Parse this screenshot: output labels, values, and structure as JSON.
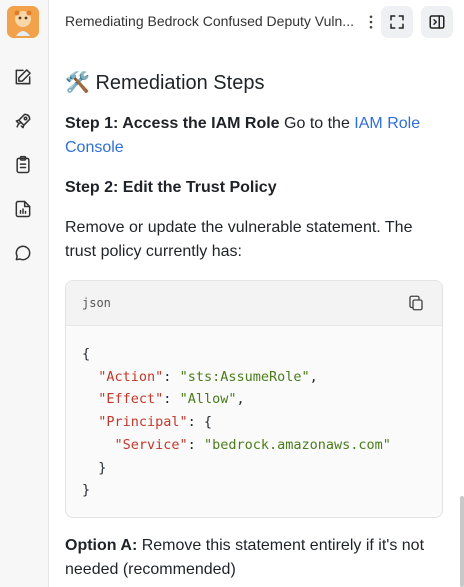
{
  "header": {
    "title": "Remediating Bedrock Confused Deputy Vuln..."
  },
  "sidebar": {
    "items": [
      {
        "icon": "edit-icon"
      },
      {
        "icon": "rocket-icon"
      },
      {
        "icon": "clipboard-icon"
      },
      {
        "icon": "report-icon"
      },
      {
        "icon": "chat-icon"
      }
    ]
  },
  "content": {
    "heading": "Remediation Steps",
    "heading_emoji": "🛠️",
    "step1_bold": "Step 1: Access the IAM Role",
    "step1_text": " Go to the ",
    "step1_link": "IAM Role Console",
    "step2_bold": "Step 2: Edit the Trust Policy",
    "para": "Remove or update the vulnerable statement. The trust policy currently has:",
    "code_lang": "json",
    "code": {
      "open": "{",
      "action_key": "\"Action\"",
      "action_val": "\"sts:AssumeRole\"",
      "effect_key": "\"Effect\"",
      "effect_val": "\"Allow\"",
      "principal_key": "\"Principal\"",
      "service_key": "\"Service\"",
      "service_val": "\"bedrock.amazonaws.com\"",
      "inner_close": "}",
      "close": "}"
    },
    "optionA_bold": "Option A:",
    "optionA_text": " Remove this statement entirely if it's not needed (recommended)"
  }
}
